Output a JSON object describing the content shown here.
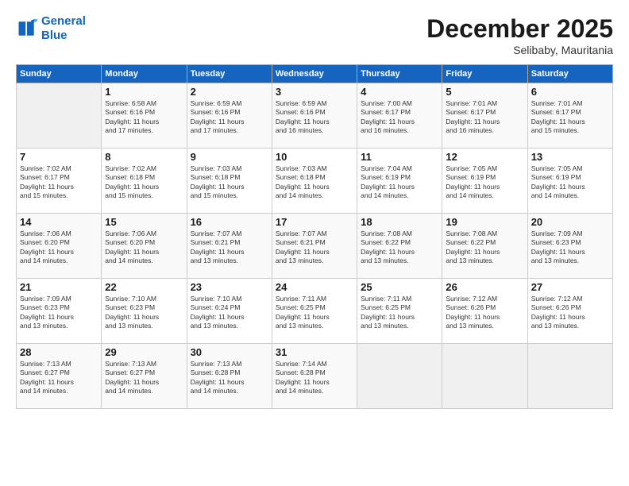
{
  "logo": {
    "line1": "General",
    "line2": "Blue"
  },
  "title": "December 2025",
  "subtitle": "Selibaby, Mauritania",
  "days_header": [
    "Sunday",
    "Monday",
    "Tuesday",
    "Wednesday",
    "Thursday",
    "Friday",
    "Saturday"
  ],
  "weeks": [
    [
      {
        "day": "",
        "info": ""
      },
      {
        "day": "1",
        "info": "Sunrise: 6:58 AM\nSunset: 6:16 PM\nDaylight: 11 hours\nand 17 minutes."
      },
      {
        "day": "2",
        "info": "Sunrise: 6:59 AM\nSunset: 6:16 PM\nDaylight: 11 hours\nand 17 minutes."
      },
      {
        "day": "3",
        "info": "Sunrise: 6:59 AM\nSunset: 6:16 PM\nDaylight: 11 hours\nand 16 minutes."
      },
      {
        "day": "4",
        "info": "Sunrise: 7:00 AM\nSunset: 6:17 PM\nDaylight: 11 hours\nand 16 minutes."
      },
      {
        "day": "5",
        "info": "Sunrise: 7:01 AM\nSunset: 6:17 PM\nDaylight: 11 hours\nand 16 minutes."
      },
      {
        "day": "6",
        "info": "Sunrise: 7:01 AM\nSunset: 6:17 PM\nDaylight: 11 hours\nand 15 minutes."
      }
    ],
    [
      {
        "day": "7",
        "info": "Sunrise: 7:02 AM\nSunset: 6:17 PM\nDaylight: 11 hours\nand 15 minutes."
      },
      {
        "day": "8",
        "info": "Sunrise: 7:02 AM\nSunset: 6:18 PM\nDaylight: 11 hours\nand 15 minutes."
      },
      {
        "day": "9",
        "info": "Sunrise: 7:03 AM\nSunset: 6:18 PM\nDaylight: 11 hours\nand 15 minutes."
      },
      {
        "day": "10",
        "info": "Sunrise: 7:03 AM\nSunset: 6:18 PM\nDaylight: 11 hours\nand 14 minutes."
      },
      {
        "day": "11",
        "info": "Sunrise: 7:04 AM\nSunset: 6:19 PM\nDaylight: 11 hours\nand 14 minutes."
      },
      {
        "day": "12",
        "info": "Sunrise: 7:05 AM\nSunset: 6:19 PM\nDaylight: 11 hours\nand 14 minutes."
      },
      {
        "day": "13",
        "info": "Sunrise: 7:05 AM\nSunset: 6:19 PM\nDaylight: 11 hours\nand 14 minutes."
      }
    ],
    [
      {
        "day": "14",
        "info": "Sunrise: 7:06 AM\nSunset: 6:20 PM\nDaylight: 11 hours\nand 14 minutes."
      },
      {
        "day": "15",
        "info": "Sunrise: 7:06 AM\nSunset: 6:20 PM\nDaylight: 11 hours\nand 14 minutes."
      },
      {
        "day": "16",
        "info": "Sunrise: 7:07 AM\nSunset: 6:21 PM\nDaylight: 11 hours\nand 13 minutes."
      },
      {
        "day": "17",
        "info": "Sunrise: 7:07 AM\nSunset: 6:21 PM\nDaylight: 11 hours\nand 13 minutes."
      },
      {
        "day": "18",
        "info": "Sunrise: 7:08 AM\nSunset: 6:22 PM\nDaylight: 11 hours\nand 13 minutes."
      },
      {
        "day": "19",
        "info": "Sunrise: 7:08 AM\nSunset: 6:22 PM\nDaylight: 11 hours\nand 13 minutes."
      },
      {
        "day": "20",
        "info": "Sunrise: 7:09 AM\nSunset: 6:23 PM\nDaylight: 11 hours\nand 13 minutes."
      }
    ],
    [
      {
        "day": "21",
        "info": "Sunrise: 7:09 AM\nSunset: 6:23 PM\nDaylight: 11 hours\nand 13 minutes."
      },
      {
        "day": "22",
        "info": "Sunrise: 7:10 AM\nSunset: 6:23 PM\nDaylight: 11 hours\nand 13 minutes."
      },
      {
        "day": "23",
        "info": "Sunrise: 7:10 AM\nSunset: 6:24 PM\nDaylight: 11 hours\nand 13 minutes."
      },
      {
        "day": "24",
        "info": "Sunrise: 7:11 AM\nSunset: 6:25 PM\nDaylight: 11 hours\nand 13 minutes."
      },
      {
        "day": "25",
        "info": "Sunrise: 7:11 AM\nSunset: 6:25 PM\nDaylight: 11 hours\nand 13 minutes."
      },
      {
        "day": "26",
        "info": "Sunrise: 7:12 AM\nSunset: 6:26 PM\nDaylight: 11 hours\nand 13 minutes."
      },
      {
        "day": "27",
        "info": "Sunrise: 7:12 AM\nSunset: 6:26 PM\nDaylight: 11 hours\nand 13 minutes."
      }
    ],
    [
      {
        "day": "28",
        "info": "Sunrise: 7:13 AM\nSunset: 6:27 PM\nDaylight: 11 hours\nand 14 minutes."
      },
      {
        "day": "29",
        "info": "Sunrise: 7:13 AM\nSunset: 6:27 PM\nDaylight: 11 hours\nand 14 minutes."
      },
      {
        "day": "30",
        "info": "Sunrise: 7:13 AM\nSunset: 6:28 PM\nDaylight: 11 hours\nand 14 minutes."
      },
      {
        "day": "31",
        "info": "Sunrise: 7:14 AM\nSunset: 6:28 PM\nDaylight: 11 hours\nand 14 minutes."
      },
      {
        "day": "",
        "info": ""
      },
      {
        "day": "",
        "info": ""
      },
      {
        "day": "",
        "info": ""
      }
    ]
  ]
}
